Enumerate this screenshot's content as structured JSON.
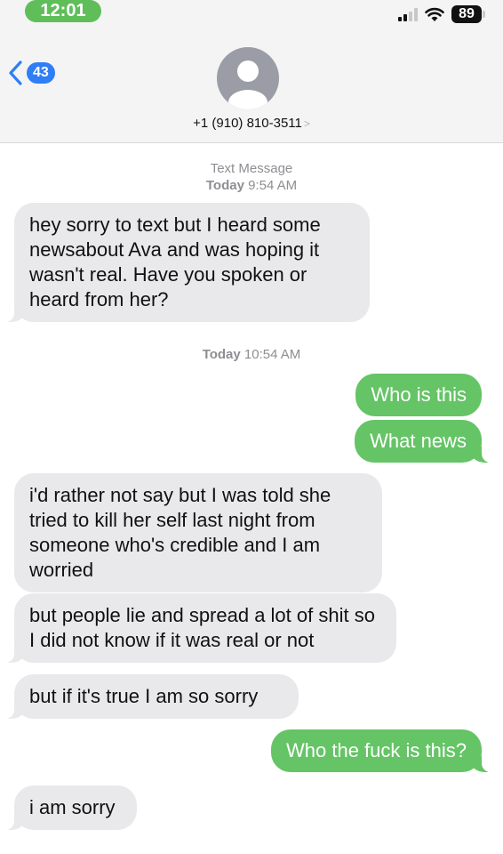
{
  "status_bar": {
    "time": "12:01",
    "battery": "89"
  },
  "header": {
    "back_count": "43",
    "contact": "+1 (910) 810-3511",
    "contact_chevron": ">"
  },
  "meta": {
    "first_service": "Text Message",
    "first_day": "Today",
    "first_time": "9:54 AM",
    "second_day": "Today",
    "second_time": "10:54 AM"
  },
  "messages": [
    {
      "direction": "incoming",
      "text": "hey sorry to text but I heard some newsabout Ava and was hoping it wasn't real. Have you spoken or heard from her?"
    },
    {
      "direction": "outgoing",
      "text": "Who is this"
    },
    {
      "direction": "outgoing",
      "text": "What news"
    },
    {
      "direction": "incoming",
      "text": "i'd rather not say but I was told she tried to kill her self last night from someone who's credible and I am worried"
    },
    {
      "direction": "incoming",
      "text": "but people lie and spread a lot of shit so I did not know if it was real or not"
    },
    {
      "direction": "incoming",
      "text": "but if it's true I am so sorry"
    },
    {
      "direction": "outgoing",
      "text": "Who the fuck is this?"
    },
    {
      "direction": "incoming",
      "text": "i am sorry"
    }
  ],
  "colors": {
    "incoming_bubble": "#e9e9eb",
    "outgoing_bubble": "#65c466",
    "badge": "#2f7ef6",
    "time_pill": "#5fbe5a"
  },
  "icons": [
    "back-chevron-icon",
    "avatar-icon",
    "signal-icon",
    "wifi-icon",
    "battery-icon"
  ]
}
